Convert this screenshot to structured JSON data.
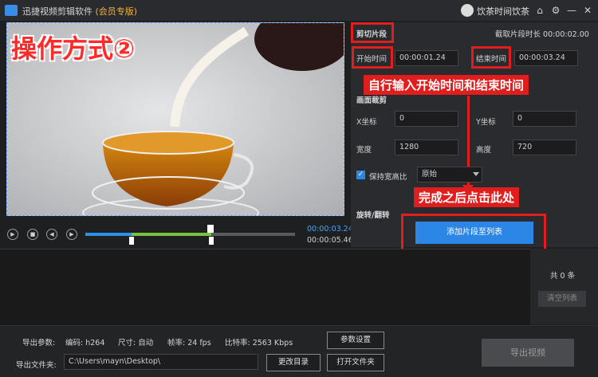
{
  "app": {
    "title": "迅捷视频剪辑软件",
    "edition": "(会员专版)",
    "username": "饮茶时间饮茶"
  },
  "window_buttons": [
    "home-icon",
    "settings-icon",
    "minimize-icon",
    "close-icon"
  ],
  "annotations": {
    "method": "操作方式②",
    "input_hint": "自行输入开始时间和结束时间",
    "click_hint": "完成之后点击此处"
  },
  "player": {
    "current_time": "00:00:03.24",
    "total_time": "00:00:05.46",
    "progress_fraction": 0.59,
    "clip_start_fraction": 0.22,
    "clip_end_fraction": 0.59
  },
  "clip": {
    "section_title": "剪切片段",
    "duration_label": "截取片段时长 00:00:02.00",
    "start_label": "开始时间",
    "start_value": "00:00:01.24",
    "end_label": "结束时间",
    "end_value": "00:00:03.24"
  },
  "crop": {
    "section_title": "画面裁剪",
    "x_label": "X坐标",
    "x_value": "0",
    "y_label": "Y坐标",
    "y_value": "0",
    "width_label": "宽度",
    "width_value": "1280",
    "height_label": "高度",
    "height_value": "720",
    "keep_ratio_label": "保持宽高比",
    "keep_ratio_checked": true,
    "ratio_option": "原始"
  },
  "rotate": {
    "section_title": "旋转/翻转"
  },
  "add_button": "添加片段至列表",
  "list": {
    "count_label": "共 0 条",
    "clear_button": "清空列表"
  },
  "export": {
    "params_label": "导出参数:",
    "codec": "编码: h264",
    "size": "尺寸: 自动",
    "fps": "帧率: 24 fps",
    "bitrate": "比特率: 2563 Kbps",
    "params_button": "参数设置",
    "folder_label": "导出文件夹:",
    "folder_path": "C:\\Users\\mayn\\Desktop\\",
    "change_dir_button": "更改目录",
    "open_folder_button": "打开文件夹",
    "export_button": "导出视频"
  },
  "colors": {
    "accent": "#2c86e6",
    "annotation_red": "#e01e1e",
    "timeline_green": "#7ac142",
    "timeline_blue": "#2f8fe8"
  }
}
